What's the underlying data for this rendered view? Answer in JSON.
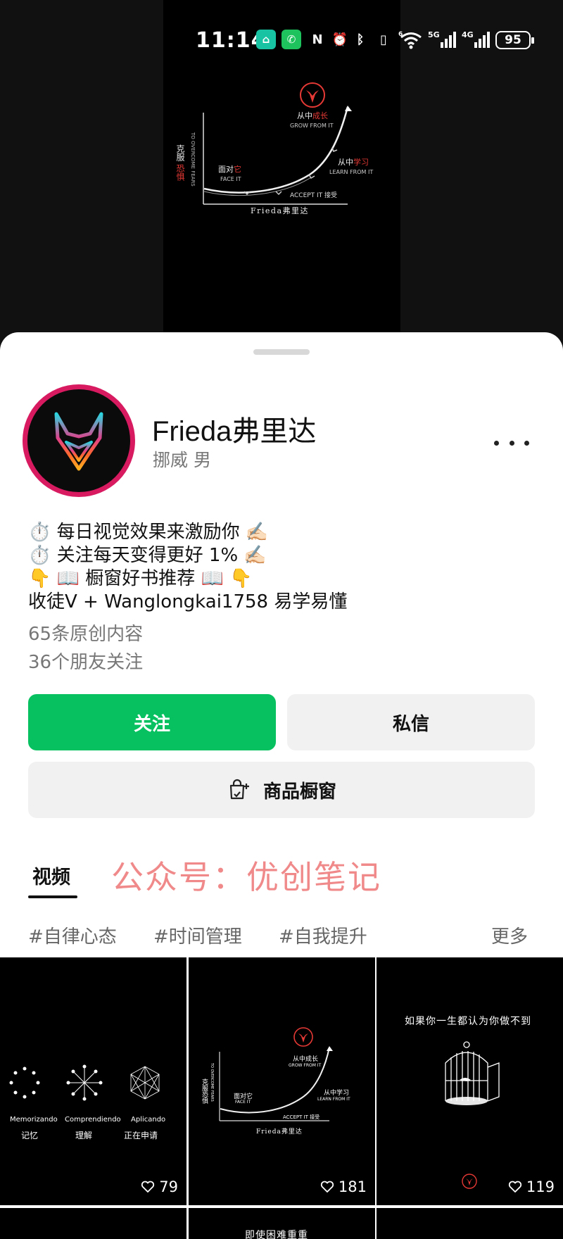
{
  "status_bar": {
    "time": "11:14",
    "battery": "95",
    "icons": [
      "mi-icon",
      "wechat-icon",
      "nfc-icon",
      "alarm-icon",
      "bluetooth-icon",
      "vibrate-icon",
      "wifi-6-icon",
      "signal-5g-icon",
      "signal-4g-icon",
      "battery-icon"
    ]
  },
  "top_video": {
    "graph_label_grow_cn_a": "从中",
    "graph_label_grow_cn_b": "成长",
    "graph_label_grow_en": "GROW FROM IT",
    "graph_label_learn_cn_a": "从中",
    "graph_label_learn_cn_b": "学习",
    "graph_label_learn_en": "LEARN FROM IT",
    "graph_label_face_cn_a": "面对",
    "graph_label_face_cn_b": "它",
    "graph_label_face_en": "FACE IT",
    "graph_label_accept": "ACCEPT IT 接受",
    "graph_ylabel_cn_a": "克服",
    "graph_ylabel_cn_b": "恐惧",
    "graph_ylabel_en": "TO OVERCOME FEARS",
    "graph_xlabel": "Frieda弗里达"
  },
  "profile": {
    "name": "Frieda弗里达",
    "subline": "挪威 男",
    "bio_lines": [
      "⏱️ 每日视觉效果来激励你 ✍🏻",
      "⏱️ 关注每天变得更好 1% ✍🏻",
      "👇 📖 橱窗好书推荐 📖  👇",
      "收徒V + Wanglongkai1758 易学易懂"
    ],
    "original_count": "65条原创内容",
    "friends_follow": "36个朋友关注"
  },
  "actions": {
    "follow": "关注",
    "message": "私信",
    "shop": "商品橱窗"
  },
  "tabs": {
    "video": "视频"
  },
  "watermark": "公众号：优创笔记",
  "tags": [
    "#自律心态",
    "#时间管理",
    "#我提升"
  ],
  "tags_full": [
    "#自律心态",
    "#时间管理",
    "#自我提升"
  ],
  "tags_more": "更多",
  "videos": [
    {
      "likes": "79",
      "captions": [
        {
          "en": "Memorizando",
          "cn": "记忆"
        },
        {
          "en": "Comprendiendo",
          "cn": "理解"
        },
        {
          "en": "Aplicando",
          "cn": "正在申请"
        }
      ]
    },
    {
      "likes": "181",
      "mini": {
        "grow": "从中成长",
        "grow_en": "GROW FROM IT",
        "learn": "从中学习",
        "learn_en": "LEARN FROM IT",
        "face": "面对它",
        "face_en": "FACE IT",
        "accept": "ACCEPT IT 接受",
        "y_cn": "克服恐惧",
        "y_en": "TO OVERCOME FEARS",
        "x": "Frieda弗里达"
      }
    },
    {
      "likes": "119",
      "title": "如果你一生都认为你做不到"
    }
  ],
  "videos_row2": [
    {
      "title": ""
    },
    {
      "title": "即使困难重重"
    },
    {
      "title": ""
    }
  ],
  "colors": {
    "follow_button": "#07c160",
    "avatar_ring": "#d81b60",
    "watermark": "#f08a8a",
    "accent_red": "#e53935"
  }
}
